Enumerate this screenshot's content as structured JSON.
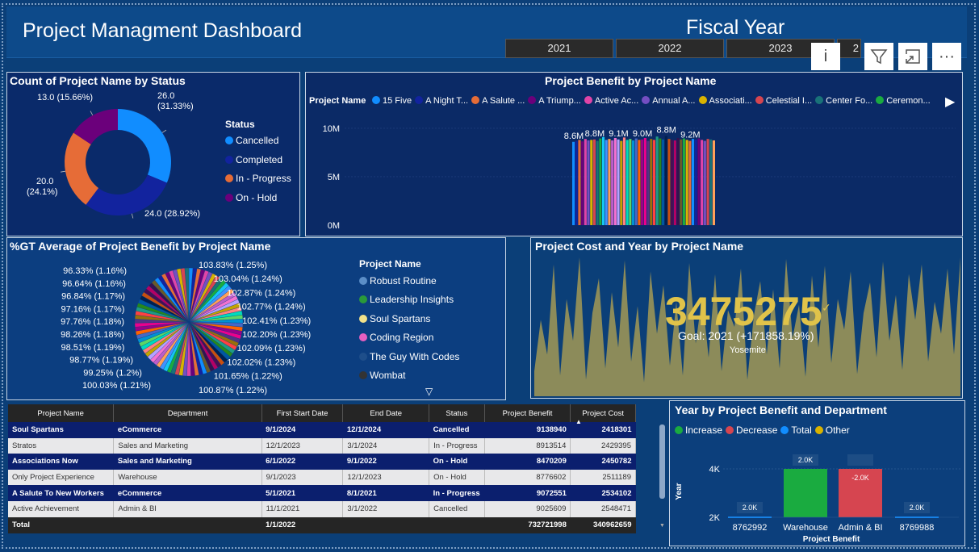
{
  "header": {
    "title": "Project Managment Dashboard",
    "fiscal_label": "Fiscal Year",
    "years": [
      "2021",
      "2022",
      "2023",
      "2"
    ],
    "icons": [
      "info-icon",
      "filter-icon",
      "focus-mode-icon",
      "more-options-icon"
    ]
  },
  "status_chart": {
    "title": "Count of Project Name by Status",
    "legend_title": "Status",
    "chart_data": {
      "type": "pie",
      "categories": [
        "Cancelled",
        "Completed",
        "In - Progress",
        "On - Hold"
      ],
      "values": [
        26,
        24,
        20,
        13
      ],
      "percent_labels": [
        "26.0 (31.33%)",
        "24.0 (28.92%)",
        "20.0 (24.1%)",
        "13.0 (15.66%)"
      ],
      "colors": [
        "#118dff",
        "#12239e",
        "#e66c37",
        "#6b007b"
      ],
      "donut": true
    }
  },
  "benefit_chart": {
    "title": "Project Benefit by Project Name",
    "legend_title": "Project Name",
    "legend": [
      {
        "name": "15 Five",
        "color": "#118dff"
      },
      {
        "name": "A Night T...",
        "color": "#12239e"
      },
      {
        "name": "A Salute ...",
        "color": "#e66c37"
      },
      {
        "name": "A Triump...",
        "color": "#6b007b"
      },
      {
        "name": "Active Ac...",
        "color": "#e044a7"
      },
      {
        "name": "Annual A...",
        "color": "#744ec2"
      },
      {
        "name": "Associati...",
        "color": "#d9b300"
      },
      {
        "name": "Celestial I...",
        "color": "#d64550"
      },
      {
        "name": "Center Fo...",
        "color": "#197278"
      },
      {
        "name": "Ceremon...",
        "color": "#1aab40"
      }
    ],
    "yticks": [
      "10M",
      "5M",
      "0M"
    ],
    "data_labels": [
      "8.6M",
      "8.8M",
      "9.1M",
      "9.0M",
      "8.8M",
      "9.2M"
    ],
    "chart_data": {
      "type": "bar",
      "ylim": [
        0,
        10500000
      ],
      "yticks": [
        0,
        5000000,
        10000000
      ],
      "values": [
        8600000,
        8700000,
        8800000,
        8650000,
        8900000,
        8750000,
        8800000,
        8850000,
        8700000,
        8950000,
        9100000,
        8800000,
        8900000,
        8750000,
        9000000,
        8850000,
        8700000,
        9050000,
        8800000,
        8900000,
        8750000,
        8950000,
        8800000,
        8850000,
        9000000,
        8700000,
        8900000,
        8800000,
        9150000,
        8950000,
        8850000,
        9200000,
        8900000,
        8800000,
        8750000,
        9000000,
        8850000,
        8950000,
        8800000,
        8700000,
        8900000,
        8850000,
        8950000,
        8800000,
        8700000,
        8900000,
        8850000,
        8750000
      ],
      "colors": [
        "#118dff",
        "#12239e",
        "#e66c37",
        "#6b007b",
        "#e044a7",
        "#744ec2",
        "#d9b300",
        "#d64550",
        "#197278",
        "#1aab40",
        "#15c6f4",
        "#4092ff",
        "#ffa058",
        "#be5dc9",
        "#f472d0",
        "#b5a1ff",
        "#c4a200",
        "#ff8080",
        "#00dbbc",
        "#5bd667",
        "#0091d5",
        "#4668c5",
        "#ff6300",
        "#99008a",
        "#ec008c",
        "#533285",
        "#99700a",
        "#ff4141",
        "#1f9a85",
        "#25891c",
        "#0057a2",
        "#002050",
        "#c94f0f",
        "#450f54",
        "#b60064",
        "#34124f",
        "#6a5a29",
        "#1aab40",
        "#d9b300",
        "#e66c37",
        "#118dff",
        "#12239e",
        "#6b007b",
        "#e044a7",
        "#744ec2",
        "#d64550",
        "#197278",
        "#ffa058"
      ],
      "data_labels": [
        {
          "index": 0,
          "text": "8.6M"
        },
        {
          "index": 7,
          "text": "8.8M"
        },
        {
          "index": 15,
          "text": "9.1M"
        },
        {
          "index": 23,
          "text": "9.0M"
        },
        {
          "index": 31,
          "text": "8.8M"
        },
        {
          "index": 39,
          "text": "9.2M"
        }
      ]
    }
  },
  "gt_chart": {
    "title": "%GT Average of Project Benefit by Project Name",
    "legend_title": "Project Name",
    "legend": [
      {
        "name": "Robust Routine",
        "color": "#5b8ec7"
      },
      {
        "name": "Leadership Insights",
        "color": "#2a9a3a"
      },
      {
        "name": "Soul Spartans",
        "color": "#f2e28a"
      },
      {
        "name": "Coding Region",
        "color": "#e65fc0"
      },
      {
        "name": "The Guy With Codes",
        "color": "#1e4e8a"
      },
      {
        "name": "Wombat",
        "color": "#333333"
      }
    ],
    "labels_left": [
      "96.33% (1.16%)",
      "96.64% (1.16%)",
      "96.84% (1.17%)",
      "97.16% (1.17%)",
      "97.76% (1.18%)",
      "98.26% (1.18%)",
      "98.51% (1.19%)",
      "98.77% (1.19%)",
      "99.25% (1.2%)",
      "100.03% (1.21%)"
    ],
    "labels_right": [
      "103.83% (1.25%)",
      "103.04% (1.24%)",
      "102.87% (1.24%)",
      "102.77% (1.24%)",
      "102.41% (1.23%)",
      "102.20% (1.23%)",
      "102.09% (1.23%)",
      "102.02% (1.23%)",
      "101.65% (1.22%)",
      "100.87% (1.22%)"
    ],
    "chart_data": {
      "type": "pie",
      "slice_count": 83,
      "shown_slices": [
        {
          "label": "103.83% (1.25%)",
          "value": 103.83
        },
        {
          "label": "103.04% (1.24%)",
          "value": 103.04
        },
        {
          "label": "102.87% (1.24%)",
          "value": 102.87
        },
        {
          "label": "102.77% (1.24%)",
          "value": 102.77
        },
        {
          "label": "102.41% (1.23%)",
          "value": 102.41
        },
        {
          "label": "102.20% (1.23%)",
          "value": 102.2
        },
        {
          "label": "102.09% (1.23%)",
          "value": 102.09
        },
        {
          "label": "102.02% (1.23%)",
          "value": 102.02
        },
        {
          "label": "101.65% (1.22%)",
          "value": 101.65
        },
        {
          "label": "100.87% (1.22%)",
          "value": 100.87
        },
        {
          "label": "100.03% (1.21%)",
          "value": 100.03
        },
        {
          "label": "99.25% (1.2%)",
          "value": 99.25
        },
        {
          "label": "98.77% (1.19%)",
          "value": 98.77
        },
        {
          "label": "98.51% (1.19%)",
          "value": 98.51
        },
        {
          "label": "98.26% (1.18%)",
          "value": 98.26
        },
        {
          "label": "97.76% (1.18%)",
          "value": 97.76
        },
        {
          "label": "97.16% (1.17%)",
          "value": 97.16
        },
        {
          "label": "96.84% (1.17%)",
          "value": 96.84
        },
        {
          "label": "96.64% (1.16%)",
          "value": 96.64
        },
        {
          "label": "96.33% (1.16%)",
          "value": 96.33
        }
      ]
    }
  },
  "kpi": {
    "title": "Project Cost and Year by Project Name",
    "value": "3475275",
    "goal": "Goal: 2021 (+171858.19%)",
    "sub": "Yosemite",
    "chart_data": {
      "type": "area",
      "values": [
        18,
        55,
        30,
        95,
        15,
        70,
        40,
        100,
        12,
        60,
        85,
        20,
        75,
        35,
        98,
        25,
        65,
        10,
        90,
        45,
        80,
        22,
        68,
        15,
        96,
        38,
        72,
        28,
        88,
        18,
        62,
        50,
        92,
        12,
        58,
        83,
        30,
        77,
        20,
        99,
        42,
        66,
        14,
        87,
        35,
        94,
        24,
        70,
        48,
        90,
        16,
        60,
        82,
        28,
        97,
        40,
        73,
        19,
        88,
        55,
        95,
        25,
        68,
        45,
        92,
        30,
        100
      ]
    }
  },
  "table": {
    "columns": [
      "Project Name",
      "Department",
      "First Start Date",
      "End Date",
      "Status",
      "Project Benefit",
      "Project Cost"
    ],
    "rows": [
      [
        "Soul Spartans",
        "eCommerce",
        "9/1/2024",
        "12/1/2024",
        "Cancelled",
        "9138940",
        "2418301"
      ],
      [
        "Stratos",
        "Sales and Marketing",
        "12/1/2023",
        "3/1/2024",
        "In - Progress",
        "8913514",
        "2429395"
      ],
      [
        "Associations Now",
        "Sales and Marketing",
        "6/1/2022",
        "9/1/2022",
        "On - Hold",
        "8470209",
        "2450782"
      ],
      [
        "Only Project Experience",
        "Warehouse",
        "9/1/2023",
        "12/1/2023",
        "On - Hold",
        "8776602",
        "2511189"
      ],
      [
        "A Salute To New Workers",
        "eCommerce",
        "5/1/2021",
        "8/1/2021",
        "In - Progress",
        "9072551",
        "2534102"
      ],
      [
        "Active Achievement",
        "Admin & BI",
        "11/1/2021",
        "3/1/2022",
        "Cancelled",
        "9025609",
        "2548471"
      ]
    ],
    "total": [
      "Total",
      "",
      "1/1/2022",
      "",
      "",
      "732721998",
      "340962659"
    ]
  },
  "waterfall": {
    "title": "Year by Project Benefit and Department",
    "legend": [
      {
        "name": "Increase",
        "color": "#1aab40"
      },
      {
        "name": "Decrease",
        "color": "#d64550"
      },
      {
        "name": "Total",
        "color": "#118dff"
      },
      {
        "name": "Other",
        "color": "#d9b300"
      }
    ],
    "ylabel": "Year",
    "xlabel": "Project Benefit",
    "yticks": [
      "4K",
      "2K"
    ],
    "chart_data": {
      "type": "bar",
      "subtype": "waterfall",
      "categories": [
        "8762992",
        "Warehouse",
        "Admin & BI",
        "8769988"
      ],
      "values": [
        2,
        2,
        -2,
        2
      ],
      "labels": [
        "2.0K",
        "2.0K",
        "-2.0K",
        "2.0K"
      ],
      "kinds": [
        "start",
        "Increase",
        "Decrease",
        "end"
      ],
      "ylim": [
        1900,
        4300
      ],
      "yticks": [
        2000,
        4000
      ]
    }
  }
}
